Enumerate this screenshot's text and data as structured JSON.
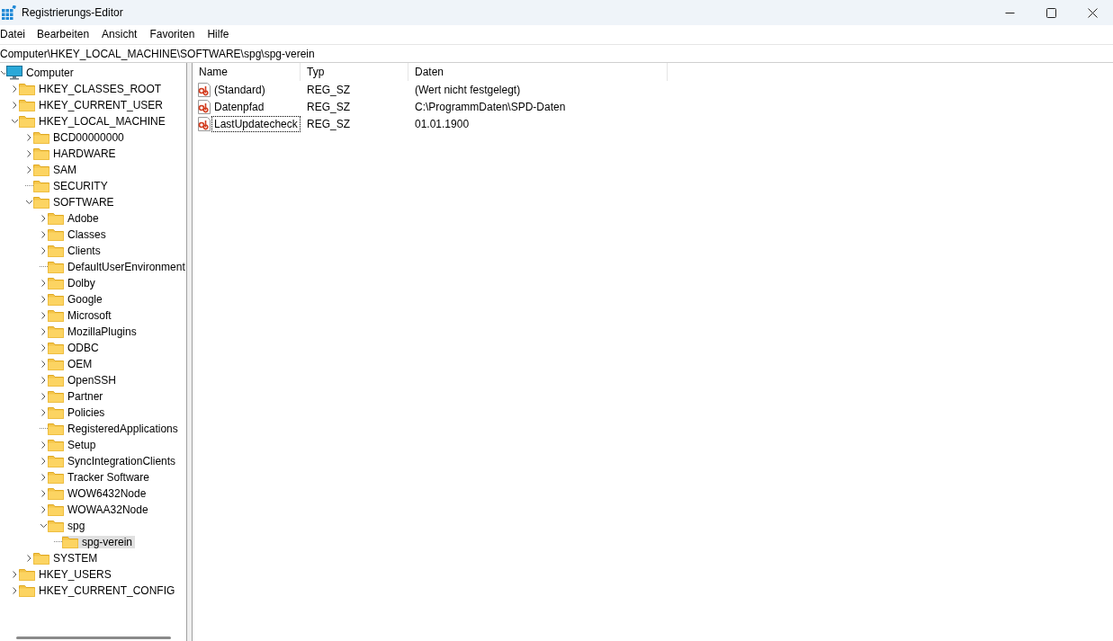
{
  "window": {
    "title": "Registrierungs-Editor"
  },
  "menu": [
    "Datei",
    "Bearbeiten",
    "Ansicht",
    "Favoriten",
    "Hilfe"
  ],
  "address": "Computer\\HKEY_LOCAL_MACHINE\\SOFTWARE\\spg\\spg-verein",
  "tree": {
    "label": "Computer",
    "kind": "computer",
    "expandable": true,
    "expanded": true,
    "selected": false,
    "children": [
      {
        "label": "HKEY_CLASSES_ROOT",
        "expandable": true,
        "expanded": false,
        "selected": false
      },
      {
        "label": "HKEY_CURRENT_USER",
        "expandable": true,
        "expanded": false,
        "selected": false
      },
      {
        "label": "HKEY_LOCAL_MACHINE",
        "expandable": true,
        "expanded": true,
        "selected": false,
        "children": [
          {
            "label": "BCD00000000",
            "expandable": true,
            "expanded": false,
            "selected": false
          },
          {
            "label": "HARDWARE",
            "expandable": true,
            "expanded": false,
            "selected": false
          },
          {
            "label": "SAM",
            "expandable": true,
            "expanded": false,
            "selected": false
          },
          {
            "label": "SECURITY",
            "expandable": false,
            "expanded": false,
            "selected": false
          },
          {
            "label": "SOFTWARE",
            "expandable": true,
            "expanded": true,
            "selected": false,
            "children": [
              {
                "label": "Adobe",
                "expandable": true,
                "expanded": false,
                "selected": false
              },
              {
                "label": "Classes",
                "expandable": true,
                "expanded": false,
                "selected": false
              },
              {
                "label": "Clients",
                "expandable": true,
                "expanded": false,
                "selected": false
              },
              {
                "label": "DefaultUserEnvironment",
                "expandable": false,
                "expanded": false,
                "selected": false
              },
              {
                "label": "Dolby",
                "expandable": true,
                "expanded": false,
                "selected": false
              },
              {
                "label": "Google",
                "expandable": true,
                "expanded": false,
                "selected": false
              },
              {
                "label": "Microsoft",
                "expandable": true,
                "expanded": false,
                "selected": false
              },
              {
                "label": "MozillaPlugins",
                "expandable": true,
                "expanded": false,
                "selected": false
              },
              {
                "label": "ODBC",
                "expandable": true,
                "expanded": false,
                "selected": false
              },
              {
                "label": "OEM",
                "expandable": true,
                "expanded": false,
                "selected": false
              },
              {
                "label": "OpenSSH",
                "expandable": true,
                "expanded": false,
                "selected": false
              },
              {
                "label": "Partner",
                "expandable": true,
                "expanded": false,
                "selected": false
              },
              {
                "label": "Policies",
                "expandable": true,
                "expanded": false,
                "selected": false
              },
              {
                "label": "RegisteredApplications",
                "expandable": false,
                "expanded": false,
                "selected": false
              },
              {
                "label": "Setup",
                "expandable": true,
                "expanded": false,
                "selected": false
              },
              {
                "label": "SyncIntegrationClients",
                "expandable": true,
                "expanded": false,
                "selected": false
              },
              {
                "label": "Tracker Software",
                "expandable": true,
                "expanded": false,
                "selected": false
              },
              {
                "label": "WOW6432Node",
                "expandable": true,
                "expanded": false,
                "selected": false
              },
              {
                "label": "WOWAA32Node",
                "expandable": true,
                "expanded": false,
                "selected": false
              },
              {
                "label": "spg",
                "expandable": true,
                "expanded": true,
                "selected": false,
                "children": [
                  {
                    "label": "spg-verein",
                    "expandable": false,
                    "expanded": false,
                    "selected": true
                  }
                ]
              }
            ]
          },
          {
            "label": "SYSTEM",
            "expandable": true,
            "expanded": false,
            "selected": false
          }
        ]
      },
      {
        "label": "HKEY_USERS",
        "expandable": true,
        "expanded": false,
        "selected": false
      },
      {
        "label": "HKEY_CURRENT_CONFIG",
        "expandable": true,
        "expanded": false,
        "selected": false
      }
    ]
  },
  "table": {
    "columns": [
      "Name",
      "Typ",
      "Daten"
    ],
    "rows": [
      {
        "name": "(Standard)",
        "type": "REG_SZ",
        "data": "(Wert nicht festgelegt)",
        "focused": false
      },
      {
        "name": "Datenpfad",
        "type": "REG_SZ",
        "data": "C:\\ProgrammDaten\\SPD-Daten",
        "focused": false
      },
      {
        "name": "LastUpdatecheck",
        "type": "REG_SZ",
        "data": "01.01.1900",
        "focused": true
      }
    ]
  }
}
